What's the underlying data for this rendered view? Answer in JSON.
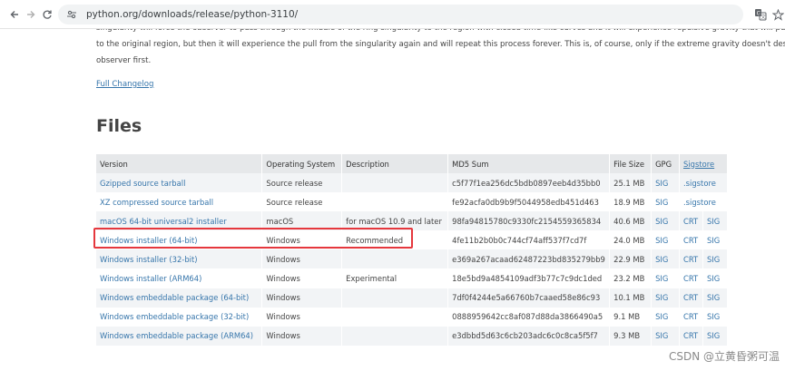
{
  "browser": {
    "url": "python.org/downloads/release/python-3110/"
  },
  "page": {
    "paragraph_lines": [
      "singularity will force the observer to pass through the middle of the ring singularity to the region with closed time-like curves and it will experience repulsive gravity that will push it back",
      "to the original region, but then it will experience the pull from the singularity again and will repeat this process forever. This is, of course, only if the extreme gravity doesn't destroy the",
      "observer first."
    ],
    "changelog_link": "Full Changelog",
    "files_heading": "Files"
  },
  "table": {
    "headers": [
      "Version",
      "Operating System",
      "Description",
      "MD5 Sum",
      "File Size",
      "GPG",
      "Sigstore"
    ],
    "rows": [
      {
        "version": "Gzipped source tarball",
        "os": "Source release",
        "description": "",
        "md5": "c5f77f1ea256dc5bdb0897eeb4d35bb0",
        "size": "25.1 MB",
        "gpg": "SIG",
        "crt": "",
        "sig": ".sigstore"
      },
      {
        "version": "XZ compressed source tarball",
        "os": "Source release",
        "description": "",
        "md5": "fe92acfa0db9b9f5044958edb451d463",
        "size": "18.9 MB",
        "gpg": "SIG",
        "crt": "",
        "sig": ".sigstore"
      },
      {
        "version": "macOS 64-bit universal2 installer",
        "os": "macOS",
        "description": "for macOS 10.9 and later",
        "md5": "98fa94815780c9330fc2154559365834",
        "size": "40.6 MB",
        "gpg": "SIG",
        "crt": "CRT",
        "sig": "SIG"
      },
      {
        "version": "Windows installer (64-bit)",
        "os": "Windows",
        "description": "Recommended",
        "md5": "4fe11b2b0b0c744cf74aff537f7cd7f",
        "size": "24.0 MB",
        "gpg": "SIG",
        "crt": "CRT",
        "sig": "SIG"
      },
      {
        "version": "Windows installer (32-bit)",
        "os": "Windows",
        "description": "",
        "md5": "e369a267acaad62487223bd835279bb9",
        "size": "22.9 MB",
        "gpg": "SIG",
        "crt": "CRT",
        "sig": "SIG"
      },
      {
        "version": "Windows installer (ARM64)",
        "os": "Windows",
        "description": "Experimental",
        "md5": "18e5bd9a4854109adf3b77c7c9dc1ded",
        "size": "23.2 MB",
        "gpg": "SIG",
        "crt": "CRT",
        "sig": "SIG"
      },
      {
        "version": "Windows embeddable package (64-bit)",
        "os": "Windows",
        "description": "",
        "md5": "7df0f4244e5a66760b7caaed58e86c93",
        "size": "10.1 MB",
        "gpg": "SIG",
        "crt": "CRT",
        "sig": "SIG"
      },
      {
        "version": "Windows embeddable package (32-bit)",
        "os": "Windows",
        "description": "",
        "md5": "0888959642cc8af087d88da3866490a5",
        "size": "9.1 MB",
        "gpg": "SIG",
        "crt": "CRT",
        "sig": "SIG"
      },
      {
        "version": "Windows embeddable package (ARM64)",
        "os": "Windows",
        "description": "",
        "md5": "e3dbbd5d63c6cb203adc6c0c8ca5f5f7",
        "size": "9.3 MB",
        "gpg": "SIG",
        "crt": "CRT",
        "sig": "SIG"
      }
    ]
  },
  "watermark": "CSDN @立黄昏粥可温",
  "colors": {
    "link": "#3776ab",
    "highlight_box": "#e5373d",
    "header_bg": "#e6e8ea",
    "row_alt_bg": "#f2f4f6"
  },
  "icons": [
    "back-arrow-icon",
    "forward-arrow-icon",
    "reload-icon",
    "site-info-icon",
    "translate-icon",
    "bookmark-star-icon"
  ]
}
